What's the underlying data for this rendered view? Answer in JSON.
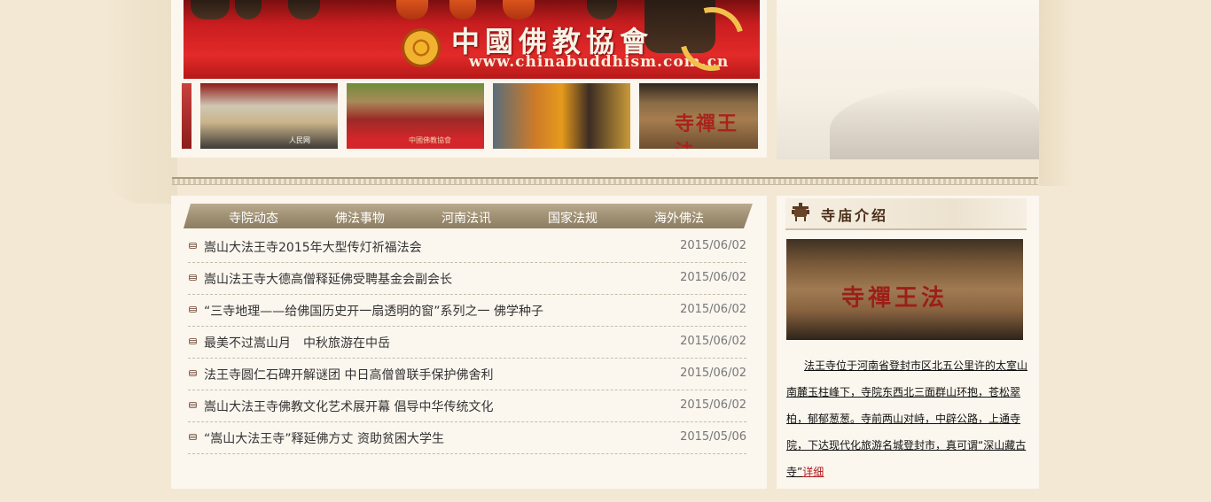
{
  "banner": {
    "title": "中國佛教協會",
    "url": "www.chinabuddhism.com.cn"
  },
  "tabs": [
    {
      "label": "寺院动态"
    },
    {
      "label": "佛法事物"
    },
    {
      "label": "河南法讯"
    },
    {
      "label": "国家法规"
    },
    {
      "label": "海外佛法"
    }
  ],
  "news": [
    {
      "title": "嵩山大法王寺2015年大型传灯祈福法会",
      "date": "2015/06/02"
    },
    {
      "title": "嵩山法王寺大德高僧释延佛受聘基金会副会长",
      "date": "2015/06/02"
    },
    {
      "title": "“三寺地理——给佛国历史开一扇透明的窗”系列之一 佛学种子",
      "date": "2015/06/02"
    },
    {
      "title": "最美不过嵩山月　中秋旅游在中岳",
      "date": "2015/06/02"
    },
    {
      "title": "法王寺圆仁石碑开解谜团 中日高僧曾联手保护佛舍利",
      "date": "2015/06/02"
    },
    {
      "title": "嵩山大法王寺佛教文化艺术展开幕 倡导中华传统文化",
      "date": "2015/06/02"
    },
    {
      "title": "“嵩山大法王寺”释延佛方丈 资助贫困大学生",
      "date": "2015/05/06"
    }
  ],
  "temple": {
    "title": "寺庙介绍",
    "sign_text": "寺禪王法",
    "description": "法王寺位于河南省登封市区北五公里许的太室山南麓玉柱峰下，寺院东西北三面群山环抱，苍松翠柏，郁郁葱葱。寺前两山对峙，中辟公路，上通寺院，下达现代化旅游名城登封市，真可谓“深山藏古寺”",
    "detail_label": "详细"
  },
  "thumbs": {
    "thumb1_caption": "人民网",
    "thumb2_caption": "中國佛教協會",
    "thumb4_sign": "寺禪王法"
  },
  "colors": {
    "background": "#f3e8d3",
    "panel": "#fbf6ee",
    "tabbar": "#9e8e72",
    "link_red": "#b3171a"
  }
}
